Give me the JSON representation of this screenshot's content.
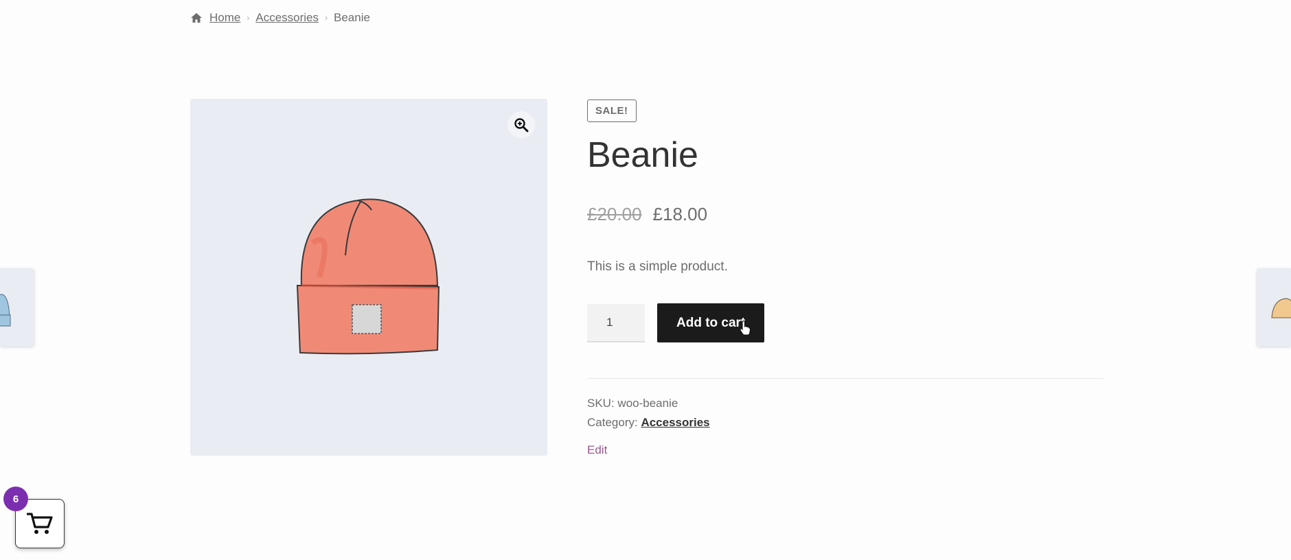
{
  "breadcrumb": {
    "home": "Home",
    "category": "Accessories",
    "current": "Beanie"
  },
  "product": {
    "badge": "SALE!",
    "title": "Beanie",
    "regular_price": "£20.00",
    "sale_price": "£18.00",
    "description": "This is a simple product.",
    "quantity": "1",
    "add_to_cart_label": "Add to cart",
    "sku_label": "SKU:",
    "sku": "woo-beanie",
    "category_label": "Category:",
    "category": "Accessories",
    "edit_label": "Edit"
  },
  "mini_cart": {
    "count": "6"
  },
  "icons": {
    "home": "home-icon",
    "zoom": "zoom-in-icon",
    "cart": "cart-icon",
    "cursor": "hand-pointer-icon"
  },
  "colors": {
    "button_bg": "#1b1b1b",
    "badge_purple": "#7b2fb0",
    "edit_link": "#96588a",
    "gallery_bg": "#e9ecf2",
    "beanie_orange": "#f08a76"
  }
}
